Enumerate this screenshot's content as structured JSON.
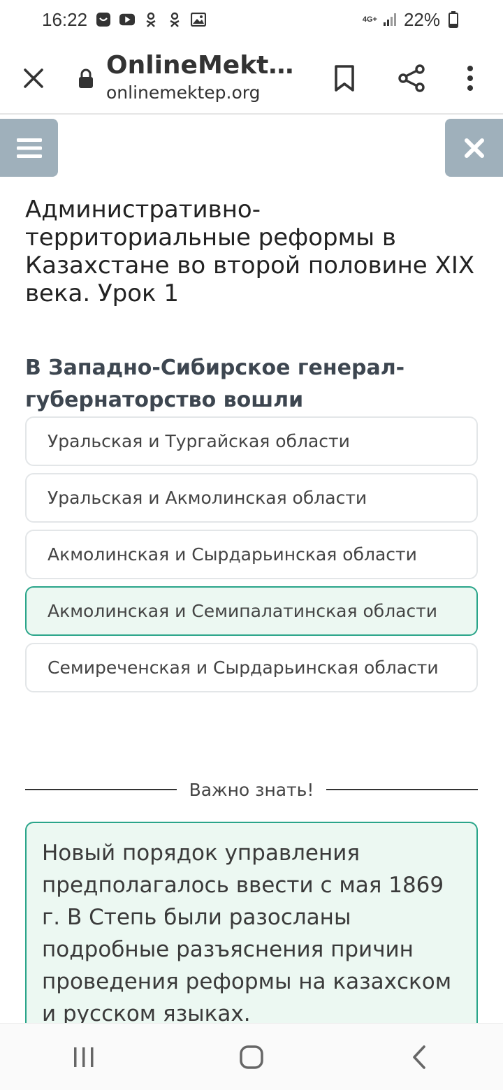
{
  "status_bar": {
    "time": "16:22",
    "network": "4G+",
    "battery": "22%"
  },
  "browser": {
    "site_title": "OnlineMekte…",
    "url": "onlinemektep.org"
  },
  "lesson": {
    "title": "Административно-территориальные реформы в Казахстане во второй половине XIX века. Урок 1"
  },
  "question": {
    "text": "В Западно-Сибирское генерал-губернаторство вошли",
    "options": [
      {
        "label": "Уральская и Тургайская области",
        "selected": false
      },
      {
        "label": "Уральская и Акмолинская области",
        "selected": false
      },
      {
        "label": "Акмолинская и Сырдарьинская области",
        "selected": false
      },
      {
        "label": "Акмолинская и Семипалатинская области",
        "selected": true
      },
      {
        "label": "Семиреченская и Сырдарьинская области",
        "selected": false
      }
    ]
  },
  "info": {
    "heading": "Важно знать!",
    "text": "Новый порядок управления предполагалось ввести с мая 1869 г. В Степь были разосланы подробные разъяснения причин проведения реформы на казахском и русском языках."
  },
  "icons": {
    "status_left": [
      "messenger-icon",
      "youtube-icon",
      "odnoklassniki-icon",
      "odnoklassniki-icon",
      "gallery-icon"
    ],
    "browser": [
      "close-icon",
      "lock-icon",
      "bookmark-icon",
      "share-icon",
      "more-vert-icon"
    ],
    "nav": [
      "recent-apps-icon",
      "home-icon",
      "back-icon"
    ]
  },
  "colors": {
    "accent": "#2aa58a",
    "selected_bg": "#ecf8f2",
    "nav_button_bg": "#9fb0bb"
  }
}
